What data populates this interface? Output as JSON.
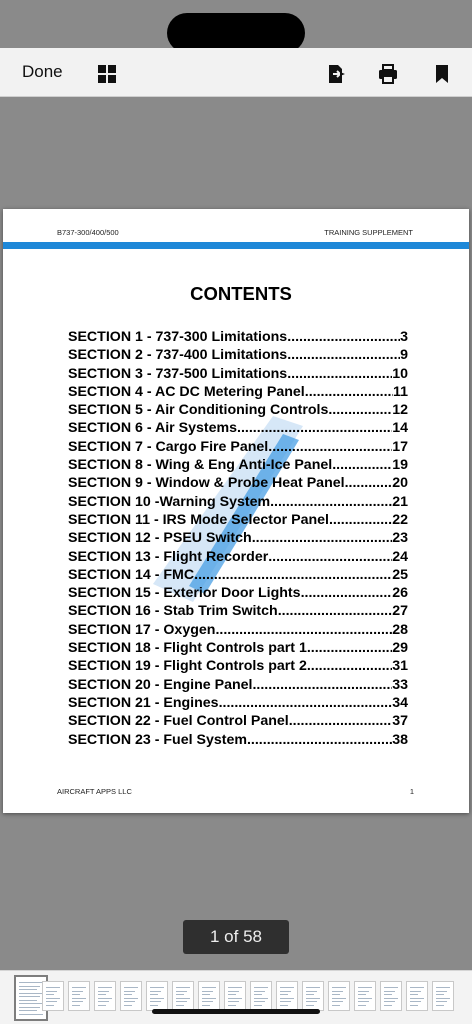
{
  "toolbar": {
    "done_label": "Done"
  },
  "icons": {
    "grid": "grid-icon",
    "share": "share-icon",
    "print": "print-icon",
    "bookmark": "bookmark-icon"
  },
  "document": {
    "header_left": "B737-300/400/500",
    "header_right": "TRAINING SUPPLEMENT",
    "title": "CONTENTS",
    "footer_left": "AIRCRAFT APPS LLC",
    "footer_right": "1",
    "accent_color": "#1e88d8",
    "toc": [
      {
        "label": "SECTION 1 - 737-300 Limitations",
        "page": "3"
      },
      {
        "label": "SECTION 2 - 737-400 Limitations",
        "page": "9"
      },
      {
        "label": "SECTION 3 - 737-500 Limitations",
        "page": "10"
      },
      {
        "label": "SECTION 4 - AC DC Metering Panel",
        "page": "11"
      },
      {
        "label": "SECTION 5 - Air Conditioning Controls ",
        "page": "12"
      },
      {
        "label": "SECTION 6 - Air Systems",
        "page": "14"
      },
      {
        "label": "SECTION 7 - Cargo Fire Panel",
        "page": "17"
      },
      {
        "label": "SECTION 8 - Wing & Eng Anti-Ice Panel",
        "page": "19"
      },
      {
        "label": "SECTION 9 - Window & Probe Heat Panel",
        "page": "20"
      },
      {
        "label": "SECTION 10 -Warning System",
        "page": "21"
      },
      {
        "label": "SECTION 11 - IRS Mode Selector Panel",
        "page": "22"
      },
      {
        "label": "SECTION 12 - PSEU Switch",
        "page": "23"
      },
      {
        "label": "SECTION 13 - Flight Recorder",
        "page": "24"
      },
      {
        "label": "SECTION 14 - FMC",
        "page": "25"
      },
      {
        "label": "SECTION 15 - Exterior Door Lights",
        "page": "26"
      },
      {
        "label": "SECTION 16 - Stab Trim Switch",
        "page": "27"
      },
      {
        "label": "SECTION 17 - Oxygen",
        "page": "28"
      },
      {
        "label": "SECTION 18 - Flight Controls part 1",
        "page": "29"
      },
      {
        "label": "SECTION 19 - Flight Controls part 2",
        "page": "31"
      },
      {
        "label": "SECTION 20 - Engine Panel",
        "page": "33"
      },
      {
        "label": "SECTION 21 - Engines",
        "page": "34"
      },
      {
        "label": "SECTION 22 - Fuel Control Panel",
        "page": "37"
      },
      {
        "label": "SECTION 23 - Fuel System",
        "page": "38"
      }
    ]
  },
  "page_indicator": "1 of 58"
}
